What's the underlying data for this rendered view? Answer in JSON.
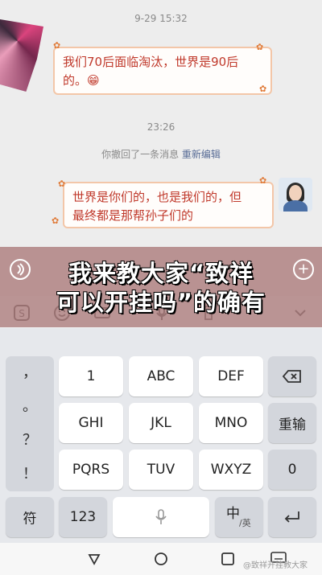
{
  "chat": {
    "time1": "9-29 15:32",
    "message1_line1": "我们70后面临淘汰，世界是90后",
    "message1_line2": "的。😁",
    "time2": "23:26",
    "recall_text": "你撤回了一条消息 ",
    "recall_edit": "重新编辑",
    "message2_line1": "世界是你们的，也是我们的，但",
    "message2_line2": "最终都是那帮孙子们的"
  },
  "overlay": {
    "line1": "我来教大家“致祥",
    "line2": "可以开挂吗”的确有"
  },
  "keyboard": {
    "punctuation": [
      "，",
      "。",
      "？",
      "！"
    ],
    "rows": [
      [
        "1",
        "ABC",
        "DEF"
      ],
      [
        "GHI",
        "JKL",
        "MNO"
      ],
      [
        "PQRS",
        "TUV",
        "WXYZ"
      ]
    ],
    "right_keys": [
      "重输",
      "0"
    ],
    "bottom": {
      "symbols": "符",
      "numbers": "123",
      "lang_main": "中",
      "lang_sub": "/英"
    }
  },
  "icons": {
    "add": "plus-icon",
    "backspace": "backspace-icon",
    "enter": "enter-icon",
    "mic": "microphone-icon"
  },
  "watermark": "@致祥开挂教大家"
}
